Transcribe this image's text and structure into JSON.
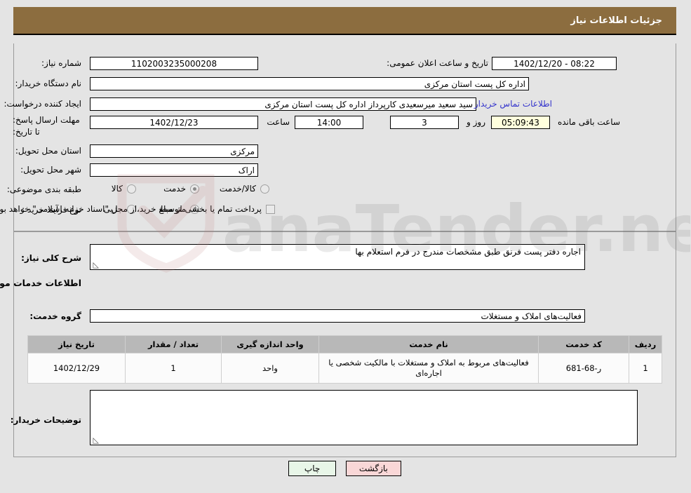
{
  "header": {
    "title": "جزئیات اطلاعات نیاز"
  },
  "form": {
    "need_number": {
      "label": "شماره نیاز:",
      "value": "1102003235000208"
    },
    "public_announce": {
      "label": "تاریخ و ساعت اعلان عمومی:",
      "value": "08:22 - 1402/12/20"
    },
    "buyer_org": {
      "label": "نام دستگاه خریدار:",
      "value": "اداره کل پست استان مرکزی"
    },
    "creator": {
      "label": "ایجاد کننده درخواست:",
      "value": "سید سعید میرسعیدی کارپرداز اداره کل پست استان مرکزی"
    },
    "contact_link": {
      "label": "اطلاعات تماس خریدار"
    },
    "deadline": {
      "label": "مهلت ارسال پاسخ: تا تاریخ:",
      "date": "1402/12/23",
      "time_label": "ساعت",
      "time": "14:00",
      "days": "3",
      "days_label": "روز و",
      "timer": "05:09:43",
      "timer_label": "ساعت باقی مانده"
    },
    "province": {
      "label": "استان محل تحویل:",
      "value": "مرکزی"
    },
    "city": {
      "label": "شهر محل تحویل:",
      "value": "اراک"
    },
    "category": {
      "label": "طبقه بندی موضوعی:",
      "options": [
        {
          "label": "کالا",
          "selected": false
        },
        {
          "label": "خدمت",
          "selected": true
        },
        {
          "label": "کالا/خدمت",
          "selected": false
        }
      ]
    },
    "purchase_type": {
      "label": "نوع فرآیند خرید :",
      "options": [
        {
          "label": "جزیی",
          "selected": false
        },
        {
          "label": "متوسط",
          "selected": true
        }
      ],
      "treasury_checkbox": {
        "label": "پرداخت تمام یا بخشی از مبلغ خرید،از محل \"اسناد خزانه اسلامی\" خواهد بود.",
        "checked": false
      }
    }
  },
  "need_summary": {
    "label": "شرح کلی نیاز:",
    "value": "اجاره دفتر پست فرنق طبق مشخصات مندرج در فرم استعلام بها"
  },
  "services_section": {
    "heading": "اطلاعات خدمات مورد نیاز",
    "service_group": {
      "label": "گروه خدمت:",
      "value": "فعالیت‌های  املاک و مستغلات"
    },
    "table": {
      "columns": [
        "ردیف",
        "کد خدمت",
        "نام خدمت",
        "واحد اندازه گیری",
        "تعداد / مقدار",
        "تاریخ نیاز"
      ],
      "rows": [
        {
          "row": "1",
          "code": "ر-68-681",
          "name": "فعالیت‌های مربوط به املاک و مستغلات با مالکیت شخصی یا اجاره‌ای",
          "unit": "واحد",
          "qty": "1",
          "date": "1402/12/29"
        }
      ]
    }
  },
  "buyer_notes": {
    "label": "توضیحات خریدار:",
    "value": ""
  },
  "buttons": {
    "print": "چاپ",
    "back": "بازگشت"
  },
  "colors": {
    "header_bg": "#8c6d3f",
    "page_bg": "#e4e4e4",
    "link": "#3333cc",
    "timer_bg": "#ffffdd",
    "table_header_bg": "#b8b8b8",
    "print_btn_bg": "#e8f6e8",
    "back_btn_bg": "#f9d7d7"
  },
  "watermark": {
    "text": "anaTender.net"
  }
}
